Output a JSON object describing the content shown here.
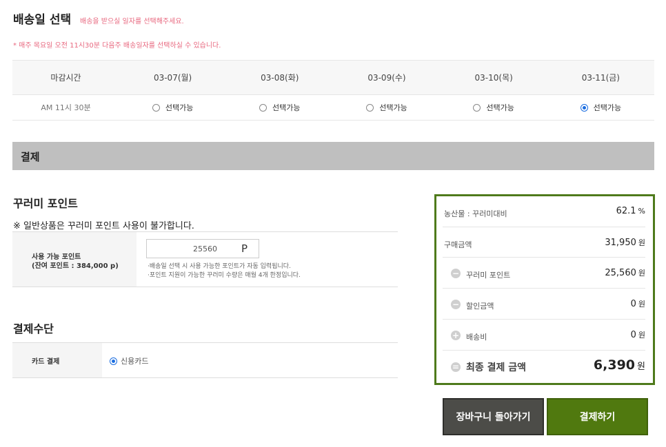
{
  "delivery": {
    "title": "배송일 선택",
    "subtitle": "배송을 받으실 일자를 선택해주세요.",
    "note": "* 매주 목요일 오전 11시30분 다음주 배송일자를 선택하실 수 있습니다.",
    "deadline_header": "마감시간",
    "deadline_value": "AM 11시 30분",
    "dates": [
      {
        "label": "03-07(월)",
        "option": "선택가능",
        "selected": false
      },
      {
        "label": "03-08(화)",
        "option": "선택가능",
        "selected": false
      },
      {
        "label": "03-09(수)",
        "option": "선택가능",
        "selected": false
      },
      {
        "label": "03-10(목)",
        "option": "선택가능",
        "selected": false
      },
      {
        "label": "03-11(금)",
        "option": "선택가능",
        "selected": true
      }
    ]
  },
  "payment_bar": {
    "title": "결제"
  },
  "points": {
    "title": "꾸러미 포인트",
    "notice": "※ 일반상품은 꾸러미 포인트 사용이 불가합니다.",
    "label": "사용 가능 포인트",
    "balance": "(잔여 포인트 : 384,000 p)",
    "input_value": "25560",
    "input_unit": "P",
    "help1": "·배송일 선택 시 사용 가능한 포인트가 자동 입력됩니다.",
    "help2": "·포인트 지원이 가능한 꾸러미 수량은 매월 4개 한정입니다."
  },
  "method": {
    "title": "결제수단",
    "label": "카드 결제",
    "option": "신용카드"
  },
  "summary": {
    "rows": [
      {
        "label": "농산물 : 꾸러미대비",
        "value": "62.1",
        "unit": "%"
      },
      {
        "label": "구매금액",
        "value": "31,950",
        "unit": "원"
      },
      {
        "label": "꾸러미 포인트",
        "value": "25,560",
        "unit": "원",
        "sign": "−"
      },
      {
        "label": "할인금액",
        "value": "0",
        "unit": "원",
        "sign": "−"
      },
      {
        "label": "배송비",
        "value": "0",
        "unit": "원",
        "sign": "+"
      }
    ],
    "final": {
      "label": "최종 결제 금액",
      "value": "6,390",
      "unit": "원",
      "sign": "="
    }
  },
  "buttons": {
    "back": "장바구니 돌아가기",
    "pay": "결제하기"
  },
  "colors": {
    "accent_green": "#50790f",
    "note_pink": "#e8687f",
    "radio_blue": "#1a6de0"
  }
}
